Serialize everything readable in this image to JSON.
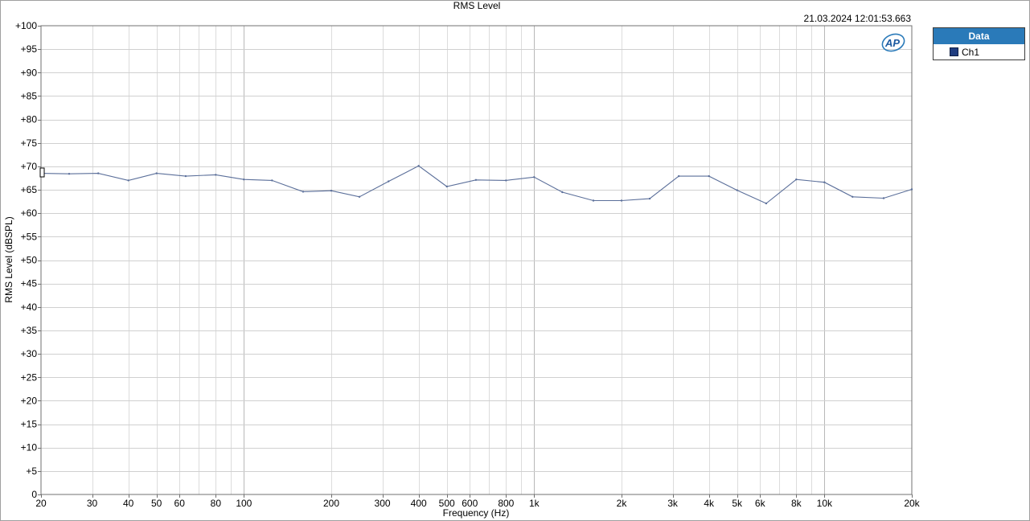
{
  "chart_data": {
    "type": "line",
    "title": "RMS Level",
    "timestamp": "21.03.2024 12:01:53.663",
    "xlabel": "Frequency (Hz)",
    "ylabel": "RMS Level (dBSPL)",
    "x_scale": "log",
    "xlim": [
      20,
      20000
    ],
    "ylim": [
      0,
      100
    ],
    "grid": true,
    "legend_placement": "right",
    "legend_title": "Data",
    "x_tick_labels": [
      {
        "value": 20,
        "label": "20"
      },
      {
        "value": 30,
        "label": "30"
      },
      {
        "value": 40,
        "label": "40"
      },
      {
        "value": 50,
        "label": "50"
      },
      {
        "value": 60,
        "label": "60"
      },
      {
        "value": 80,
        "label": "80"
      },
      {
        "value": 100,
        "label": "100"
      },
      {
        "value": 200,
        "label": "200"
      },
      {
        "value": 300,
        "label": "300"
      },
      {
        "value": 400,
        "label": "400"
      },
      {
        "value": 500,
        "label": "500"
      },
      {
        "value": 600,
        "label": "600"
      },
      {
        "value": 800,
        "label": "800"
      },
      {
        "value": 1000,
        "label": "1k"
      },
      {
        "value": 2000,
        "label": "2k"
      },
      {
        "value": 3000,
        "label": "3k"
      },
      {
        "value": 4000,
        "label": "4k"
      },
      {
        "value": 5000,
        "label": "5k"
      },
      {
        "value": 6000,
        "label": "6k"
      },
      {
        "value": 8000,
        "label": "8k"
      },
      {
        "value": 10000,
        "label": "10k"
      },
      {
        "value": 20000,
        "label": "20k"
      }
    ],
    "y_tick_labels": [
      {
        "value": 100,
        "label": "+100"
      },
      {
        "value": 95,
        "label": "+95"
      },
      {
        "value": 90,
        "label": "+90"
      },
      {
        "value": 85,
        "label": "+85"
      },
      {
        "value": 80,
        "label": "+80"
      },
      {
        "value": 75,
        "label": "+75"
      },
      {
        "value": 70,
        "label": "+70"
      },
      {
        "value": 65,
        "label": "+65"
      },
      {
        "value": 60,
        "label": "+60"
      },
      {
        "value": 55,
        "label": "+55"
      },
      {
        "value": 50,
        "label": "+50"
      },
      {
        "value": 45,
        "label": "+45"
      },
      {
        "value": 40,
        "label": "+40"
      },
      {
        "value": 35,
        "label": "+35"
      },
      {
        "value": 30,
        "label": "+30"
      },
      {
        "value": 25,
        "label": "+25"
      },
      {
        "value": 20,
        "label": "+20"
      },
      {
        "value": 15,
        "label": "+15"
      },
      {
        "value": 10,
        "label": "+10"
      },
      {
        "value": 5,
        "label": "+5"
      },
      {
        "value": 0,
        "label": "0"
      }
    ],
    "series": [
      {
        "name": "Ch1",
        "color": "#5b6f9a",
        "x": [
          20,
          25,
          31.5,
          40,
          50,
          63,
          80,
          100,
          125,
          160,
          200,
          250,
          315,
          400,
          500,
          630,
          800,
          1000,
          1250,
          1600,
          2000,
          2500,
          3150,
          4000,
          5000,
          6300,
          8000,
          10000,
          12500,
          16000,
          20000
        ],
        "y": [
          68.5,
          68.4,
          68.5,
          67.0,
          68.5,
          67.9,
          68.2,
          67.2,
          67.0,
          64.6,
          64.8,
          63.5,
          66.8,
          70.1,
          65.7,
          67.1,
          67.0,
          67.7,
          64.5,
          62.7,
          62.7,
          63.1,
          67.9,
          67.9,
          64.9,
          62.1,
          67.2,
          66.6,
          63.5,
          63.2,
          65.1
        ]
      }
    ]
  }
}
